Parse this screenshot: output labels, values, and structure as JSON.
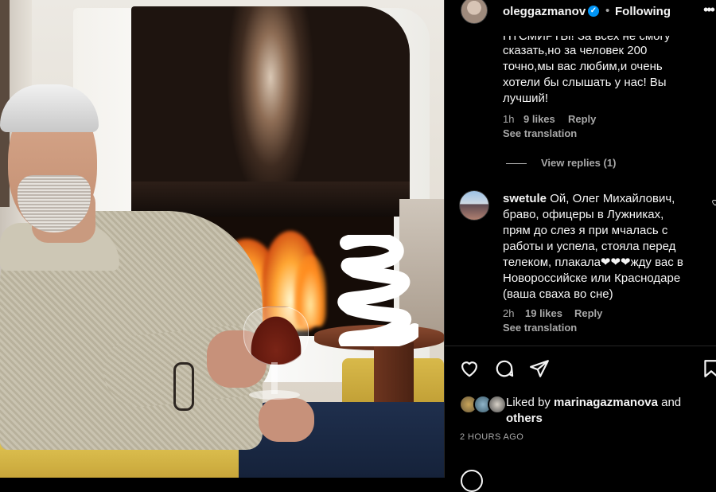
{
  "header": {
    "username": "oleggazmanov",
    "separator": "•",
    "follow_status": "Following",
    "more": "•••",
    "verified_mark": "✓"
  },
  "comment1": {
    "line0": "ПТСМИРТЫ! За всех не смогу",
    "line1": "сказать,но за человек 200",
    "line2": "точно,мы вас любим,и очень",
    "line3": "хотели бы слышать у нас! Вы",
    "line4": "лучший!",
    "time": "1h",
    "likes": "9 likes",
    "reply": "Reply",
    "see_translation": "See translation",
    "view_replies": "View replies (1)"
  },
  "comment2": {
    "username": "swetule",
    "line1": "Ой, Олег Михайлович,",
    "line2": "браво, офицеры в Лужниках,",
    "line3": "прям до слез я при мчалась с",
    "line4": "работы и успела, стояла перед",
    "line5": "телеком, плакала❤❤❤жду вас в",
    "line6": "Новороссийске или Краснодаре",
    "line7": "(ваша сваха во сне)",
    "time": "2h",
    "likes": "19 likes",
    "reply": "Reply",
    "see_translation": "See translation"
  },
  "actions": {
    "like_icon": "heart-outline-icon",
    "comment_icon": "comment-bubble-icon",
    "share_icon": "paper-plane-icon",
    "save_icon": "bookmark-icon"
  },
  "likes": {
    "prefix": "Liked by",
    "user": "marinagazmanova",
    "and": "and",
    "others": "others"
  },
  "posted": "2 HOURS AGO",
  "colors": {
    "background": "#000000",
    "text": "#f5f5f5",
    "muted": "#a8a8a8",
    "verified": "#0095f6"
  }
}
